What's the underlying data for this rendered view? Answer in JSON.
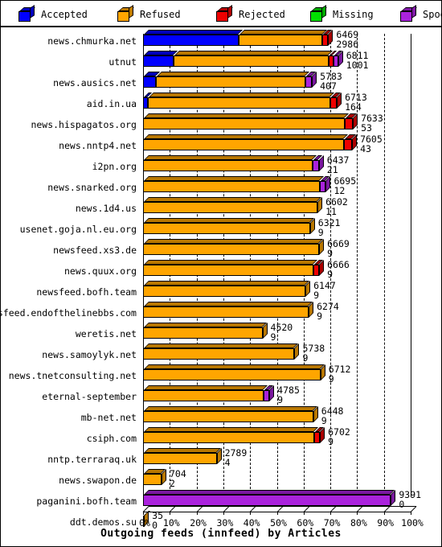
{
  "legend": {
    "items": [
      {
        "label": "Accepted",
        "color": "#0000ff",
        "icon": "cube-icon"
      },
      {
        "label": "Refused",
        "color": "#ffa500",
        "icon": "cube-icon"
      },
      {
        "label": "Rejected",
        "color": "#ee0000",
        "icon": "cube-icon"
      },
      {
        "label": "Missing",
        "color": "#00e000",
        "icon": "cube-icon"
      },
      {
        "label": "Spooled",
        "color": "#aa22dd",
        "icon": "cube-icon"
      }
    ]
  },
  "chart_data": {
    "type": "bar",
    "title": "Outgoing feeds (innfeed) by Articles",
    "xlabel": "Outgoing feeds (innfeed) by Articles",
    "ylabel": "",
    "orientation": "horizontal",
    "stacked": true,
    "grid": true,
    "legend_position": "top",
    "xlim": [
      0,
      100
    ],
    "xunit": "%",
    "xticks": [
      "0%",
      "10%",
      "20%",
      "30%",
      "40%",
      "50%",
      "60%",
      "70%",
      "80%",
      "90%",
      "100%"
    ],
    "xtickvalues": [
      0,
      10,
      20,
      30,
      40,
      50,
      60,
      70,
      80,
      90,
      100
    ],
    "series": [
      {
        "name": "Accepted",
        "color": "#0000ff"
      },
      {
        "name": "Refused",
        "color": "#ffa500"
      },
      {
        "name": "Rejected",
        "color": "#ee0000"
      },
      {
        "name": "Missing",
        "color": "#00e000"
      },
      {
        "name": "Spooled",
        "color": "#aa22dd"
      }
    ],
    "categories": [
      "news.chmurka.net",
      "utnut",
      "news.ausics.net",
      "aid.in.ua",
      "news.hispagatos.org",
      "news.nntp4.net",
      "i2pn.org",
      "news.snarked.org",
      "news.1d4.us",
      "usenet.goja.nl.eu.org",
      "newsfeed.xs3.de",
      "news.quux.org",
      "newsfeed.bofh.team",
      "newsfeed.endofthelinebbs.com",
      "weretis.net",
      "news.samoylyk.net",
      "news.tnetconsulting.net",
      "eternal-september",
      "mb-net.net",
      "csiph.com",
      "nntp.terraraq.uk",
      "news.swapon.de",
      "paganini.bofh.team",
      "ddt.demos.su"
    ],
    "rows": [
      {
        "category": "news.chmurka.net",
        "total": 6469,
        "accepted": 2986,
        "labels": [
          "6469",
          "2986"
        ],
        "segments": [
          {
            "name": "Accepted",
            "pct": 35.6
          },
          {
            "name": "Refused",
            "pct": 31.4
          },
          {
            "name": "Rejected",
            "pct": 2.2
          }
        ]
      },
      {
        "category": "utnut",
        "total": 6811,
        "accepted": 1001,
        "labels": [
          "6811",
          "1001"
        ],
        "segments": [
          {
            "name": "Accepted",
            "pct": 11.5
          },
          {
            "name": "Refused",
            "pct": 58.0
          },
          {
            "name": "Rejected",
            "pct": 1.6
          },
          {
            "name": "Spooled",
            "pct": 1.8
          }
        ]
      },
      {
        "category": "news.ausics.net",
        "total": 5783,
        "accepted": 407,
        "labels": [
          "5783",
          "407"
        ],
        "segments": [
          {
            "name": "Accepted",
            "pct": 4.7
          },
          {
            "name": "Refused",
            "pct": 56.0
          },
          {
            "name": "Spooled",
            "pct": 2.4
          }
        ]
      },
      {
        "category": "aid.in.ua",
        "total": 6713,
        "accepted": 164,
        "labels": [
          "6713",
          "164"
        ],
        "segments": [
          {
            "name": "Accepted",
            "pct": 1.9
          },
          {
            "name": "Refused",
            "pct": 68.2
          },
          {
            "name": "Rejected",
            "pct": 2.3
          }
        ]
      },
      {
        "category": "news.hispagatos.org",
        "total": 7633,
        "accepted": 53,
        "labels": [
          "7633",
          "53"
        ],
        "segments": [
          {
            "name": "Refused",
            "pct": 75.3
          },
          {
            "name": "Rejected",
            "pct": 3.1
          }
        ]
      },
      {
        "category": "news.nntp4.net",
        "total": 7605,
        "accepted": 43,
        "labels": [
          "7605",
          "43"
        ],
        "segments": [
          {
            "name": "Refused",
            "pct": 75.0
          },
          {
            "name": "Rejected",
            "pct": 3.1
          }
        ]
      },
      {
        "category": "i2pn.org",
        "total": 6437,
        "accepted": 21,
        "labels": [
          "6437",
          "21"
        ],
        "segments": [
          {
            "name": "Refused",
            "pct": 63.5
          },
          {
            "name": "Spooled",
            "pct": 2.2
          }
        ]
      },
      {
        "category": "news.snarked.org",
        "total": 6695,
        "accepted": 12,
        "labels": [
          "6695",
          "12"
        ],
        "segments": [
          {
            "name": "Refused",
            "pct": 66.1
          },
          {
            "name": "Spooled",
            "pct": 2.2
          }
        ]
      },
      {
        "category": "news.1d4.us",
        "total": 6602,
        "accepted": 11,
        "labels": [
          "6602",
          "11"
        ],
        "segments": [
          {
            "name": "Refused",
            "pct": 65.2
          }
        ]
      },
      {
        "category": "usenet.goja.nl.eu.org",
        "total": 6321,
        "accepted": 9,
        "labels": [
          "6321",
          "9"
        ],
        "segments": [
          {
            "name": "Refused",
            "pct": 62.4
          }
        ]
      },
      {
        "category": "newsfeed.xs3.de",
        "total": 6669,
        "accepted": 9,
        "labels": [
          "6669",
          "9"
        ],
        "segments": [
          {
            "name": "Refused",
            "pct": 65.8
          }
        ]
      },
      {
        "category": "news.quux.org",
        "total": 6666,
        "accepted": 9,
        "labels": [
          "6666",
          "9"
        ],
        "segments": [
          {
            "name": "Refused",
            "pct": 63.6
          },
          {
            "name": "Rejected",
            "pct": 2.2
          }
        ]
      },
      {
        "category": "newsfeed.bofh.team",
        "total": 6147,
        "accepted": 9,
        "labels": [
          "6147",
          "9"
        ],
        "segments": [
          {
            "name": "Refused",
            "pct": 60.7
          }
        ]
      },
      {
        "category": "newsfeed.endofthelinebbs.com",
        "total": 6274,
        "accepted": 9,
        "labels": [
          "6274",
          "9"
        ],
        "segments": [
          {
            "name": "Refused",
            "pct": 61.9
          }
        ]
      },
      {
        "category": "weretis.net",
        "total": 4520,
        "accepted": 9,
        "labels": [
          "4520",
          "9"
        ],
        "segments": [
          {
            "name": "Refused",
            "pct": 44.6
          }
        ]
      },
      {
        "category": "news.samoylyk.net",
        "total": 5738,
        "accepted": 9,
        "labels": [
          "5738",
          "9"
        ],
        "segments": [
          {
            "name": "Refused",
            "pct": 56.6
          }
        ]
      },
      {
        "category": "news.tnetconsulting.net",
        "total": 6712,
        "accepted": 9,
        "labels": [
          "6712",
          "9"
        ],
        "segments": [
          {
            "name": "Refused",
            "pct": 66.3
          }
        ]
      },
      {
        "category": "eternal-september",
        "total": 4785,
        "accepted": 9,
        "labels": [
          "4785",
          "9"
        ],
        "segments": [
          {
            "name": "Refused",
            "pct": 45.0
          },
          {
            "name": "Spooled",
            "pct": 2.2
          }
        ]
      },
      {
        "category": "mb-net.net",
        "total": 6448,
        "accepted": 9,
        "labels": [
          "6448",
          "9"
        ],
        "segments": [
          {
            "name": "Refused",
            "pct": 63.6
          }
        ]
      },
      {
        "category": "csiph.com",
        "total": 6702,
        "accepted": 9,
        "labels": [
          "6702",
          "9"
        ],
        "segments": [
          {
            "name": "Refused",
            "pct": 63.9
          },
          {
            "name": "Rejected",
            "pct": 2.2
          }
        ]
      },
      {
        "category": "nntp.terraraq.uk",
        "total": 2789,
        "accepted": 4,
        "labels": [
          "2789",
          "4"
        ],
        "segments": [
          {
            "name": "Refused",
            "pct": 27.5
          }
        ]
      },
      {
        "category": "news.swapon.de",
        "total": 704,
        "accepted": 2,
        "labels": [
          "704",
          "2"
        ],
        "segments": [
          {
            "name": "Refused",
            "pct": 6.9
          }
        ]
      },
      {
        "category": "paganini.bofh.team",
        "total": 9391,
        "accepted": 0,
        "labels": [
          "9391",
          "0"
        ],
        "segments": [
          {
            "name": "Spooled",
            "pct": 92.6
          }
        ]
      },
      {
        "category": "ddt.demos.su",
        "total": 35,
        "accepted": 0,
        "labels": [
          "35",
          "0"
        ],
        "segments": [
          {
            "name": "Refused",
            "pct": 0.35
          }
        ]
      }
    ]
  }
}
